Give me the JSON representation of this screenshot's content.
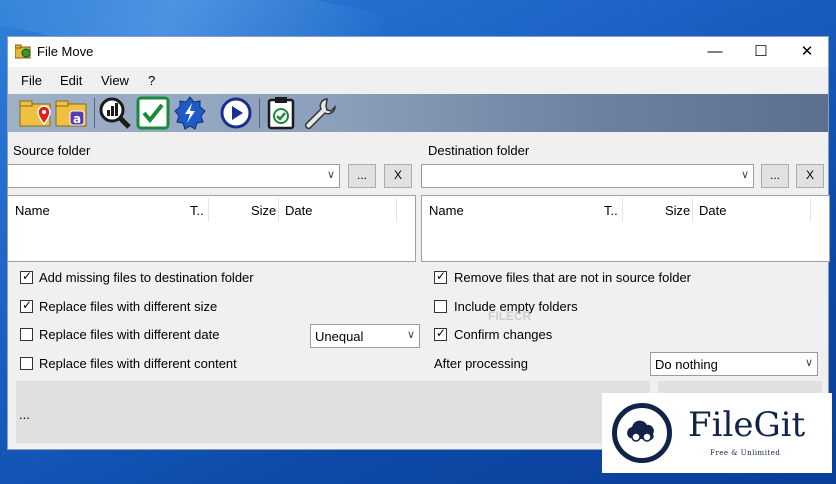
{
  "window": {
    "title": "File Move",
    "controls": [
      "—",
      "☐",
      "✕"
    ]
  },
  "menu": [
    "File",
    "Edit",
    "View",
    "?"
  ],
  "toolbar": {
    "buttons": [
      "source-folder-icon",
      "destination-folder-icon",
      "analyze-icon",
      "check-icon",
      "run-icon",
      "play-icon",
      "clipboard-check-icon",
      "settings-wrench-icon"
    ]
  },
  "source": {
    "label": "Source folder",
    "value": "",
    "browse": "...",
    "clear": "X",
    "columns": [
      "Name",
      "T..",
      "Size",
      "Date"
    ]
  },
  "destination": {
    "label": "Destination folder",
    "value": "",
    "browse": "...",
    "clear": "X",
    "columns": [
      "Name",
      "T..",
      "Size",
      "Date"
    ]
  },
  "options_left": [
    {
      "label": "Add missing files to destination folder",
      "checked": true
    },
    {
      "label": "Replace files with different size",
      "checked": true
    },
    {
      "label": "Replace files with different date",
      "checked": false
    },
    {
      "label": "Replace files with different content",
      "checked": false
    }
  ],
  "date_compare": {
    "selected": "Unequal"
  },
  "options_right": [
    {
      "label": "Remove files that are not in source folder",
      "checked": true
    },
    {
      "label": "Include empty folders",
      "checked": false
    },
    {
      "label": "Confirm changes",
      "checked": true
    }
  ],
  "after_processing": {
    "label": "After processing",
    "selected": "Do nothing"
  },
  "status": {
    "text": "..."
  },
  "watermark": {
    "brand": "FileGit",
    "tagline": "Free & Unlimited",
    "faint": "FILECR"
  }
}
